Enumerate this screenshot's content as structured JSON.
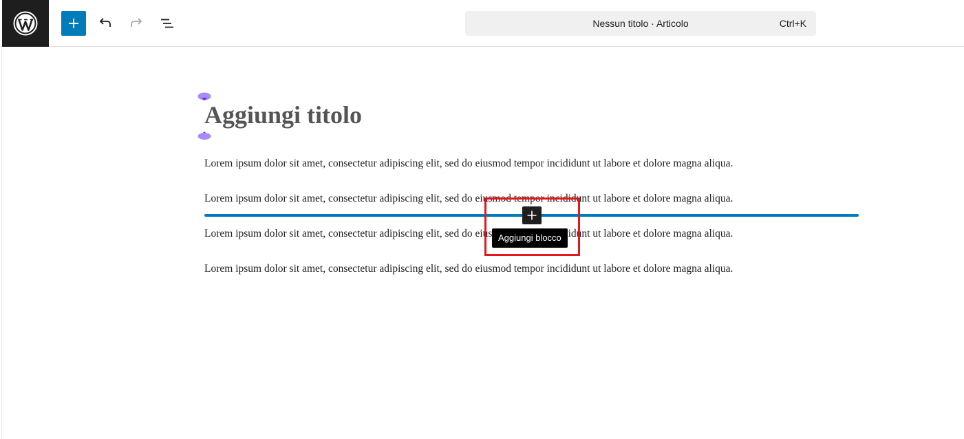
{
  "toolbar": {
    "add_block_icon": "plus-icon",
    "undo_icon": "undo-icon",
    "redo_icon": "redo-icon",
    "list_view_icon": "list-view-icon",
    "logo_icon": "wordpress-logo-icon",
    "accent_color": "#007cba"
  },
  "command_bar": {
    "title": "Nessun titolo · Articolo",
    "shortcut": "Ctrl+K"
  },
  "editor": {
    "post_title": "Aggiungi titolo",
    "paragraphs": [
      "Lorem ipsum dolor sit amet, consectetur adipiscing elit, sed do eiusmod tempor incididunt ut labore et dolore magna aliqua.",
      "Lorem ipsum dolor sit amet, consectetur adipiscing elit, sed do eiusmod tempor incididunt ut labore et dolore magna aliqua.",
      "Lorem ipsum dolor sit amet, consectetur adipiscing elit, sed do eiusmod tempor incididunt ut labore et dolore magna aliqua.",
      "Lorem ipsum dolor sit amet, consectetur adipiscing elit, sed do eiusmod tempor incididunt ut labore et dolore magna aliqua."
    ],
    "inserter_tooltip": "Aggiungi blocco",
    "highlight_color": "#e4181c"
  }
}
